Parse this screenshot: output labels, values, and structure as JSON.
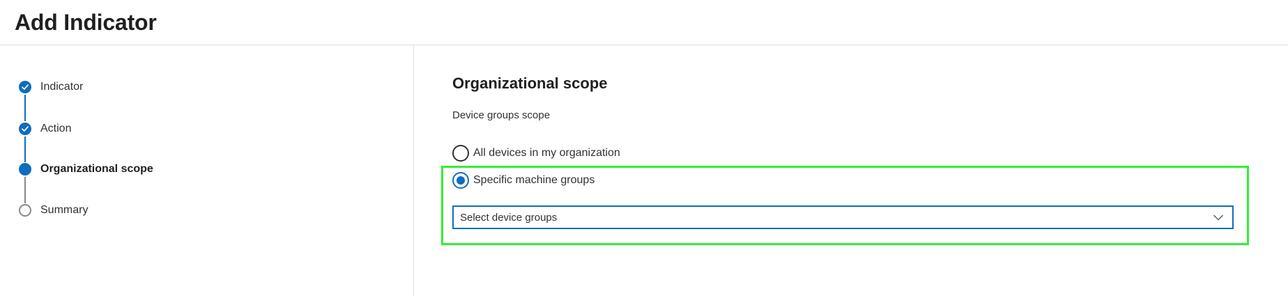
{
  "page": {
    "title": "Add Indicator"
  },
  "wizard": {
    "steps": [
      {
        "label": "Indicator",
        "state": "completed"
      },
      {
        "label": "Action",
        "state": "completed"
      },
      {
        "label": "Organizational scope",
        "state": "current"
      },
      {
        "label": "Summary",
        "state": "pending"
      }
    ]
  },
  "scope": {
    "title": "Organizational scope",
    "group_label": "Device groups scope",
    "options": [
      {
        "label": "All devices in my organization",
        "selected": false
      },
      {
        "label": "Specific machine groups",
        "selected": true
      }
    ],
    "device_groups_dropdown": {
      "placeholder": "Select device groups"
    }
  },
  "colors": {
    "accent": "#0f6cbd",
    "highlight": "#33ee33",
    "pending": "#8a8886",
    "divider": "#e1dfdd"
  },
  "icons": {
    "completed_step": "checkmark-icon",
    "dropdown": "chevron-down-icon"
  }
}
